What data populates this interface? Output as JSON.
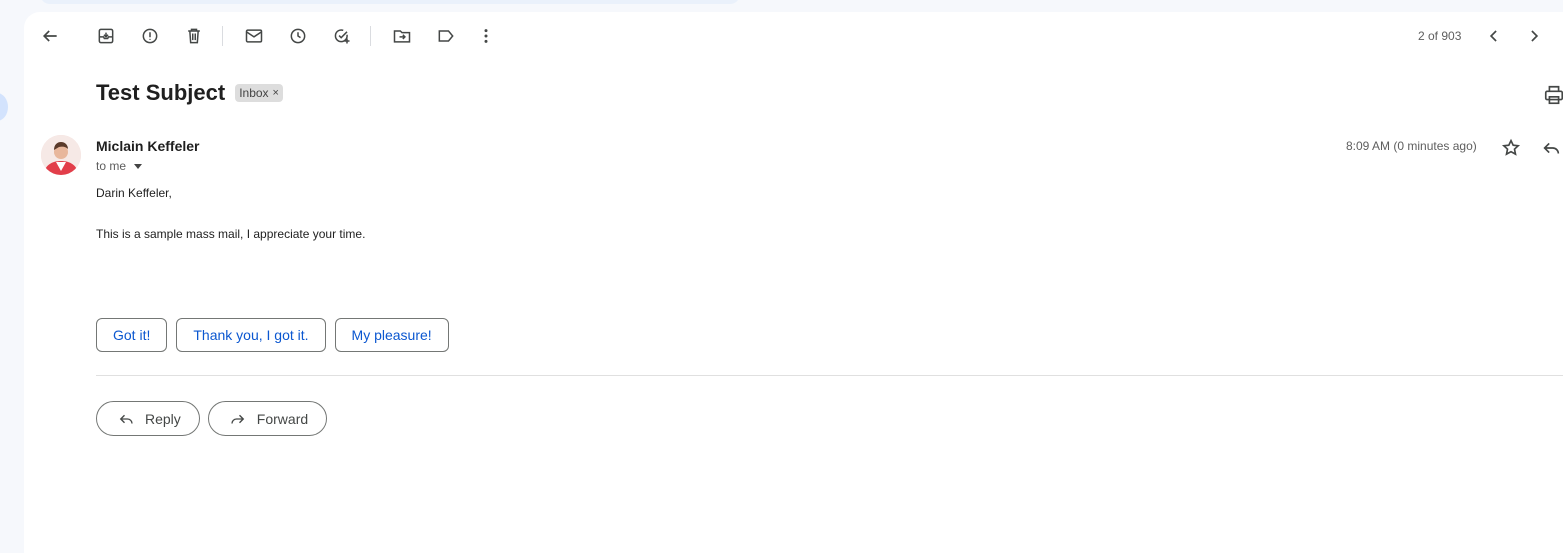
{
  "toolbar": {
    "icons": [
      "back-arrow-icon",
      "archive-icon",
      "report-spam-icon",
      "delete-icon",
      "mark-unread-icon",
      "snooze-icon",
      "add-to-tasks-icon",
      "move-to-icon",
      "labels-icon",
      "more-icon"
    ],
    "pager_text": "2 of 903",
    "older_icon": "chevron-left-icon",
    "newer_icon": "chevron-right-icon"
  },
  "email": {
    "subject": "Test Subject",
    "label_chip": "Inbox",
    "chip_remove": "×",
    "sender_name": "Miclain Keffeler",
    "recipient_text": "to me",
    "timestamp": "8:09 AM (0 minutes ago)",
    "greeting": "Darin Keffeler,",
    "body": "This is a sample mass mail, I appreciate your time."
  },
  "smart_replies": [
    "Got it!",
    "Thank you, I got it.",
    "My pleasure!"
  ],
  "actions": {
    "reply_label": "Reply",
    "forward_label": "Forward"
  },
  "colors": {
    "background": "#f6f8fc",
    "panel": "#ffffff",
    "smart_reply_text": "#0b57d0",
    "icon": "#444746"
  }
}
